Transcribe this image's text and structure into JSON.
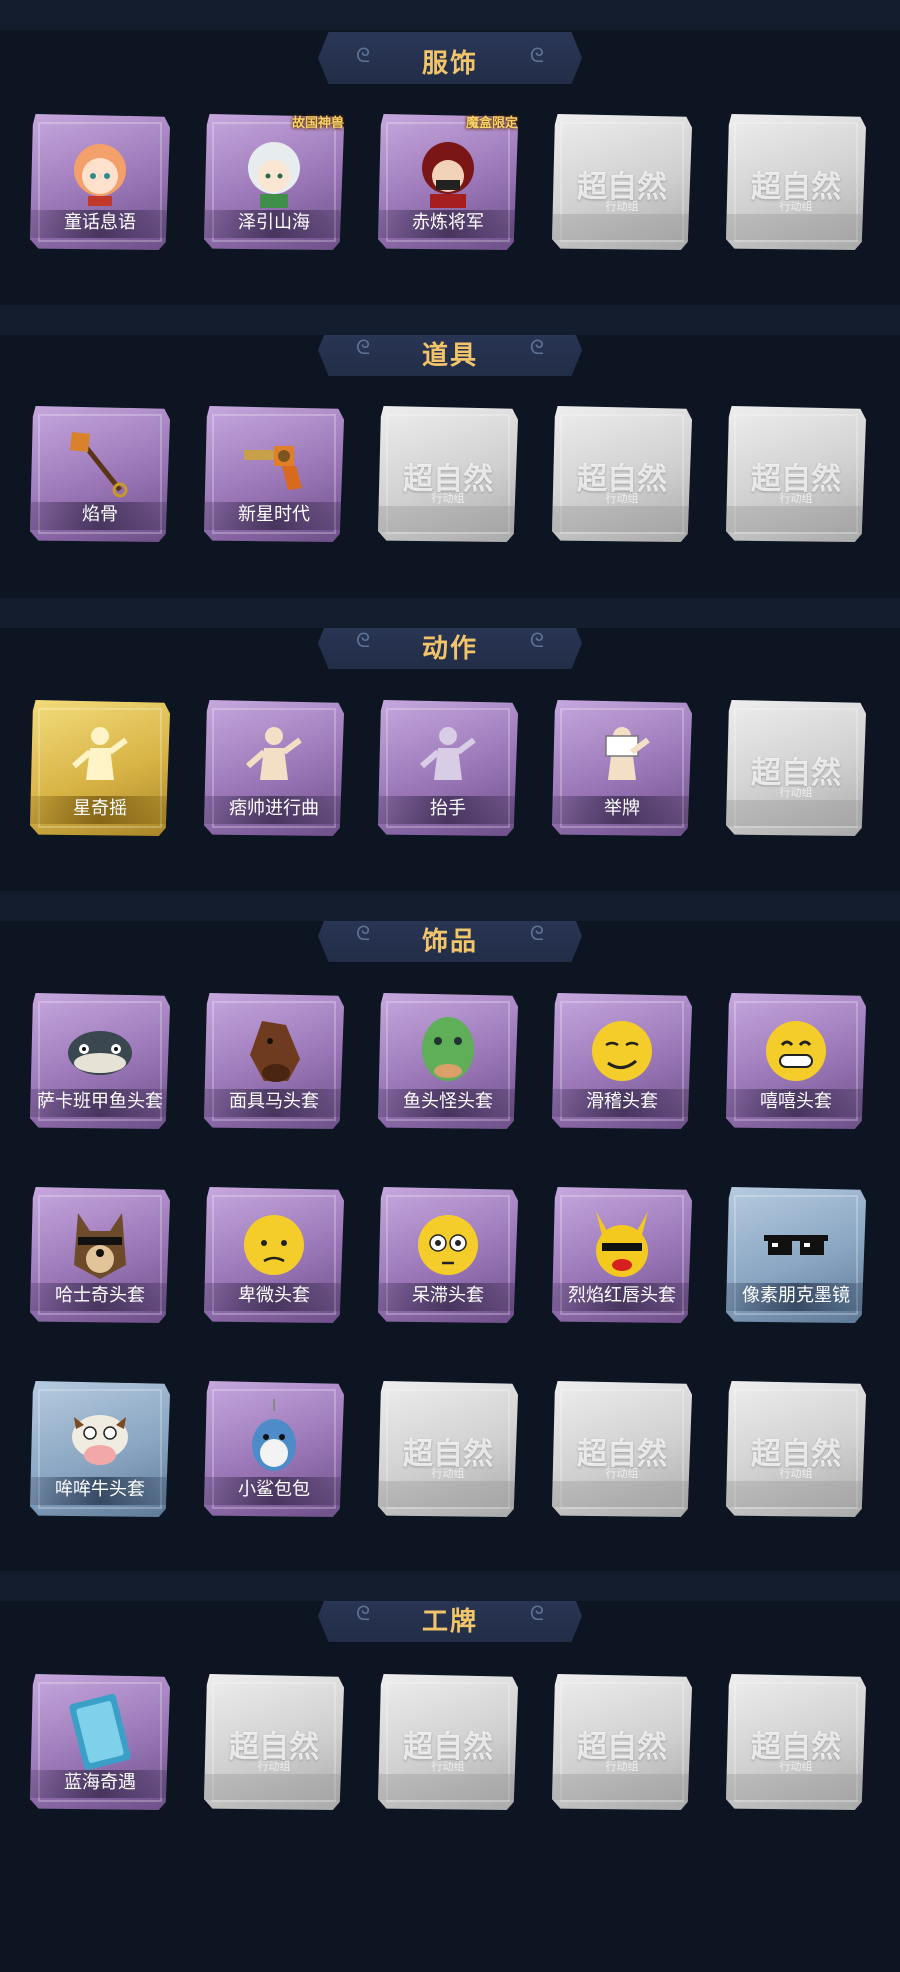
{
  "sections": [
    {
      "title": "服饰",
      "items": [
        {
          "label": "童话息语",
          "style": "purple",
          "art": "girl-avatar-icon"
        },
        {
          "label": "泽引山海",
          "style": "purple",
          "art": "white-hair-avatar-icon",
          "badge": "故国神兽"
        },
        {
          "label": "赤炼将军",
          "style": "purple",
          "art": "red-general-avatar-icon",
          "badge": "魔盒限定"
        },
        {
          "empty": true
        },
        {
          "empty": true
        }
      ]
    },
    {
      "title": "道具",
      "items": [
        {
          "label": "焰骨",
          "style": "purple",
          "art": "shovel-icon"
        },
        {
          "label": "新星时代",
          "style": "purple",
          "art": "revolver-icon"
        },
        {
          "empty": true
        },
        {
          "empty": true
        },
        {
          "empty": true
        }
      ]
    },
    {
      "title": "动作",
      "items": [
        {
          "label": "星奇摇",
          "style": "gold",
          "art": "dance-pose-icon"
        },
        {
          "label": "痞帅进行曲",
          "style": "purple",
          "art": "flex-pose-icon"
        },
        {
          "label": "抬手",
          "style": "purple",
          "art": "raise-hand-pose-icon"
        },
        {
          "label": "举牌",
          "style": "purple",
          "art": "hold-sign-pose-icon"
        },
        {
          "empty": true
        }
      ]
    },
    {
      "title": "饰品",
      "items": [
        {
          "label": "萨卡班甲鱼头套",
          "style": "purple",
          "art": "fish-head-icon"
        },
        {
          "label": "面具马头套",
          "style": "purple",
          "art": "horse-head-icon"
        },
        {
          "label": "鱼头怪头套",
          "style": "purple",
          "art": "green-fish-head-icon"
        },
        {
          "label": "滑稽头套",
          "style": "purple",
          "art": "smirk-emoji-icon"
        },
        {
          "label": "嘻嘻头套",
          "style": "purple",
          "art": "grin-emoji-icon"
        },
        {
          "label": "哈士奇头套",
          "style": "purple",
          "art": "husky-head-icon"
        },
        {
          "label": "卑微头套",
          "style": "purple",
          "art": "sad-emoji-icon"
        },
        {
          "label": "呆滞头套",
          "style": "purple",
          "art": "flushed-emoji-icon"
        },
        {
          "label": "烈焰红唇头套",
          "style": "purple",
          "art": "pikachu-head-icon"
        },
        {
          "label": "像素朋克墨镜",
          "style": "blue",
          "art": "pixel-sunglasses-icon"
        },
        {
          "label": "哞哞牛头套",
          "style": "blue",
          "art": "cow-head-icon"
        },
        {
          "label": "小鲨包包",
          "style": "purple",
          "art": "shark-bag-icon"
        },
        {
          "empty": true
        },
        {
          "empty": true
        },
        {
          "empty": true
        }
      ]
    },
    {
      "title": "工牌",
      "items": [
        {
          "label": "蓝海奇遇",
          "style": "purple",
          "art": "blue-badge-card-icon"
        },
        {
          "empty": true
        },
        {
          "empty": true
        },
        {
          "empty": true
        },
        {
          "empty": true
        }
      ]
    }
  ],
  "empty_card": {
    "watermark": "超自然",
    "subtitle": "行动组"
  },
  "colors": {
    "background": "#0d1523",
    "header_text": "#f2c56a",
    "rare_purple": "#9a76b7",
    "legend_gold": "#d8b446",
    "common_blue": "#8aa6c2"
  }
}
